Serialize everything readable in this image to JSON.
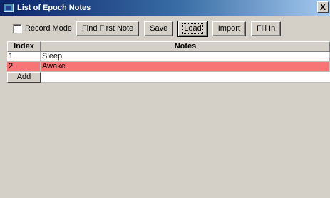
{
  "window": {
    "title": "List of Epoch Notes",
    "close_label": "X"
  },
  "toolbar": {
    "record_mode_label": "Record Mode",
    "record_mode_checked": false,
    "find_first_note_label": "Find First Note",
    "save_label": "Save",
    "load_label": "Load",
    "import_label": "Import",
    "fill_in_label": "Fill In"
  },
  "table": {
    "columns": [
      "Index",
      "Notes"
    ],
    "rows": [
      {
        "index": "1",
        "note": "Sleep",
        "highlighted": false
      },
      {
        "index": "2",
        "note": "Awake",
        "highlighted": true
      }
    ],
    "add_label": "Add"
  },
  "colors": {
    "highlight_row": "#f87575",
    "titlebar_start": "#0a246a",
    "titlebar_end": "#a6caf0",
    "window_bg": "#d4d0c8"
  }
}
